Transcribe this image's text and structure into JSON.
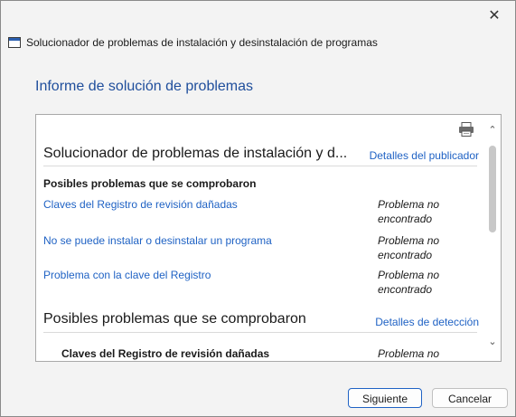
{
  "window": {
    "title": "Solucionador de problemas de instalación y desinstalación de programas",
    "close_glyph": "✕"
  },
  "report": {
    "heading": "Informe de solución de problemas",
    "section1": {
      "title": "Solucionador de problemas de instalación y d...",
      "link": "Detalles del publicador",
      "subheading": "Posibles problemas que se comprobaron",
      "rows": [
        {
          "label": "Claves del Registro de revisión dañadas",
          "status_line1": "Problema no",
          "status_line2": "encontrado"
        },
        {
          "label": "No se puede instalar o desinstalar un programa",
          "status_line1": "Problema no",
          "status_line2": "encontrado"
        },
        {
          "label": "Problema con la clave del Registro",
          "status_line1": "Problema no",
          "status_line2": "encontrado"
        }
      ]
    },
    "section2": {
      "title": "Posibles problemas que se comprobaron",
      "link": "Detalles de detección",
      "rows": [
        {
          "label": "Claves del Registro de revisión dañadas",
          "status_line1": "Problema no"
        }
      ]
    },
    "print_icon": "printer-icon"
  },
  "buttons": {
    "next": "Siguiente",
    "cancel": "Cancelar"
  },
  "colors": {
    "accent": "#1f62c4",
    "heading": "#1f4e9c",
    "background": "#f3f3f3"
  }
}
